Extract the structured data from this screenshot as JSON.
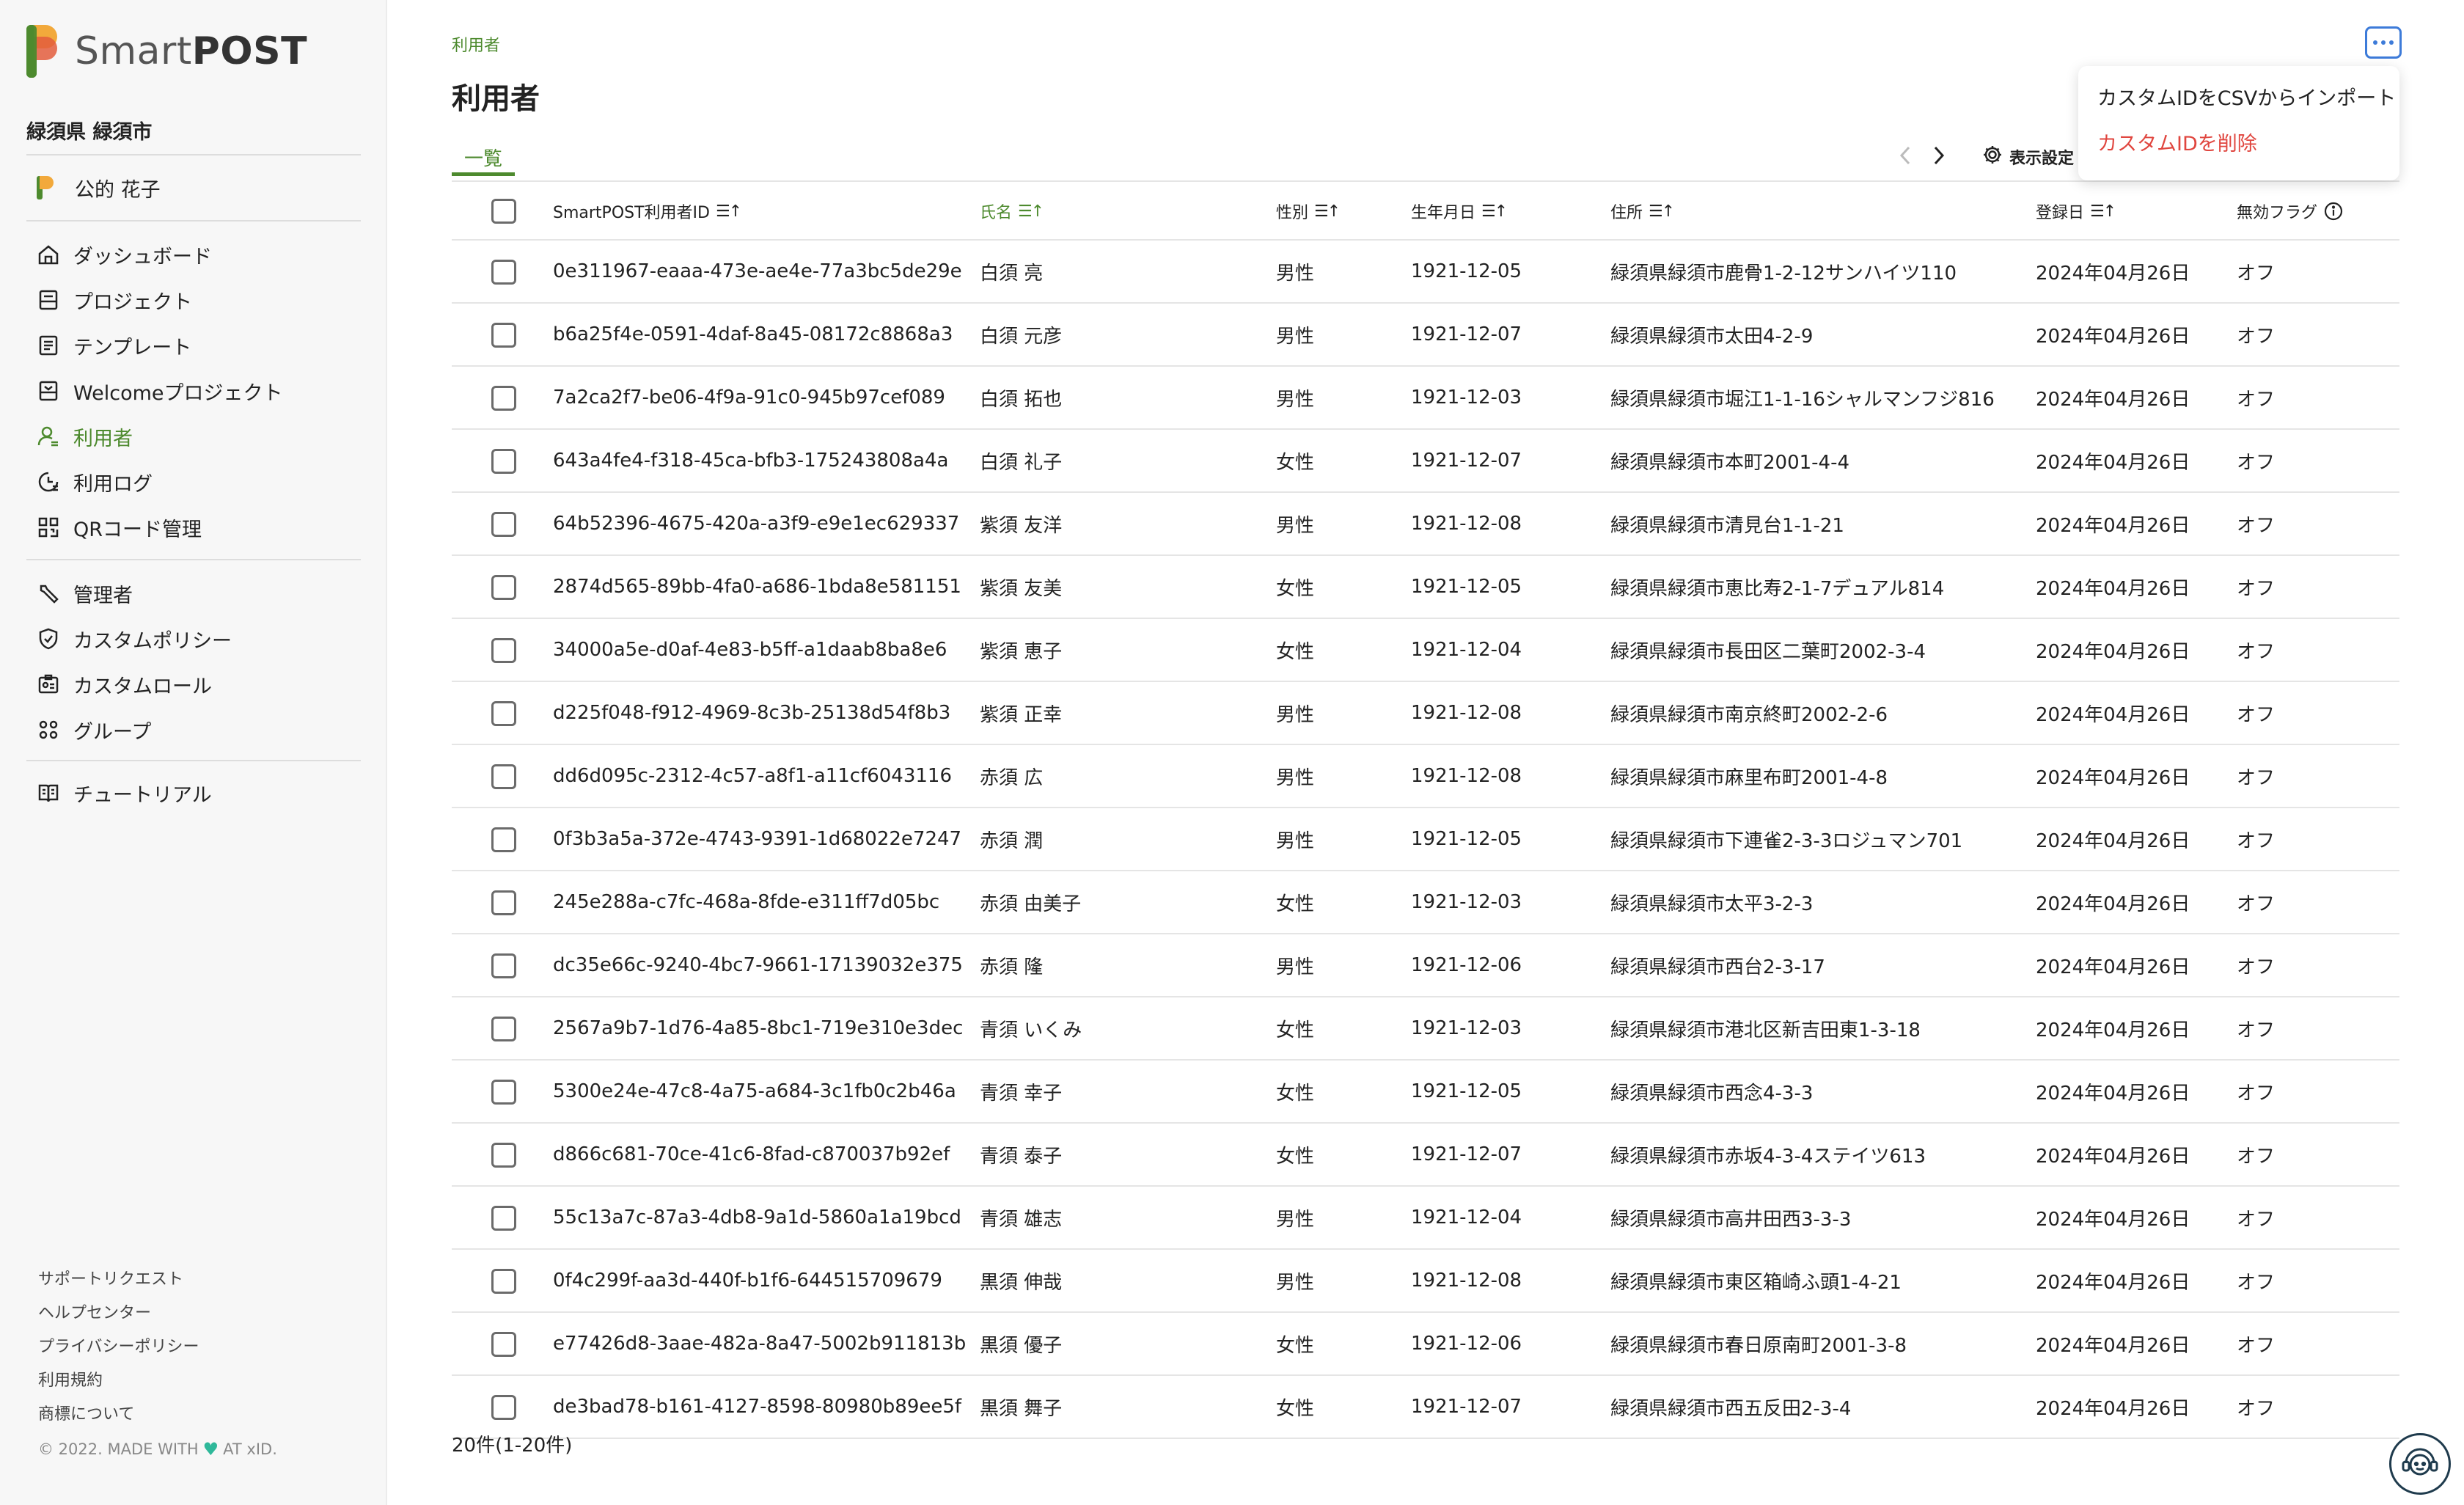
{
  "app": {
    "logo_text_light": "Smart",
    "logo_text_bold": "POST",
    "org_name": "緑須県 緑須市",
    "user_name": "公的 花子",
    "colors": {
      "accent": "#4d8a2e",
      "danger": "#e0463f",
      "focus": "#3d7bd9"
    }
  },
  "sidebar": {
    "nav_primary": [
      {
        "label": "ダッシュボード",
        "icon": "home-icon"
      },
      {
        "label": "プロジェクト",
        "icon": "project-icon"
      },
      {
        "label": "テンプレート",
        "icon": "template-icon"
      },
      {
        "label": "Welcomeプロジェクト",
        "icon": "welcome-icon"
      },
      {
        "label": "利用者",
        "icon": "user-icon",
        "active": true
      },
      {
        "label": "利用ログ",
        "icon": "log-icon"
      },
      {
        "label": "QRコード管理",
        "icon": "qr-icon"
      }
    ],
    "nav_admin": [
      {
        "label": "管理者",
        "icon": "wrench-icon"
      },
      {
        "label": "カスタムポリシー",
        "icon": "shield-icon"
      },
      {
        "label": "カスタムロール",
        "icon": "id-card-icon"
      },
      {
        "label": "グループ",
        "icon": "group-icon"
      }
    ],
    "nav_help": [
      {
        "label": "チュートリアル",
        "icon": "book-icon"
      }
    ],
    "footer_links": [
      "サポートリクエスト",
      "ヘルプセンター",
      "プライバシーポリシー",
      "利用規約",
      "商標について"
    ],
    "copyright_before": "© 2022. MADE WITH",
    "copyright_after": "AT xID."
  },
  "header": {
    "breadcrumb": "利用者",
    "title": "利用者",
    "tab": "一覧",
    "display_settings": "表示設定"
  },
  "menu": {
    "import_label": "カスタムIDをCSVからインポート",
    "delete_label": "カスタムIDを削除"
  },
  "table": {
    "columns": {
      "id": "SmartPOST利用者ID",
      "name": "氏名",
      "sex": "性別",
      "birth": "生年月日",
      "addr": "住所",
      "reg": "登録日",
      "flag": "無効フラグ"
    },
    "rows": [
      {
        "id": "0e311967-eaaa-473e-ae4e-77a3bc5de29e",
        "name": "白須 亮",
        "sex": "男性",
        "birth": "1921-12-05",
        "addr": "緑須県緑須市鹿骨1-2-12サンハイツ110",
        "reg": "2024年04月26日",
        "flag": "オフ"
      },
      {
        "id": "b6a25f4e-0591-4daf-8a45-08172c8868a3",
        "name": "白須 元彦",
        "sex": "男性",
        "birth": "1921-12-07",
        "addr": "緑須県緑須市太田4-2-9",
        "reg": "2024年04月26日",
        "flag": "オフ"
      },
      {
        "id": "7a2ca2f7-be06-4f9a-91c0-945b97cef089",
        "name": "白須 拓也",
        "sex": "男性",
        "birth": "1921-12-03",
        "addr": "緑須県緑須市堀江1-1-16シャルマンフジ816",
        "reg": "2024年04月26日",
        "flag": "オフ"
      },
      {
        "id": "643a4fe4-f318-45ca-bfb3-175243808a4a",
        "name": "白須 礼子",
        "sex": "女性",
        "birth": "1921-12-07",
        "addr": "緑須県緑須市本町2001-4-4",
        "reg": "2024年04月26日",
        "flag": "オフ"
      },
      {
        "id": "64b52396-4675-420a-a3f9-e9e1ec629337",
        "name": "紫須 友洋",
        "sex": "男性",
        "birth": "1921-12-08",
        "addr": "緑須県緑須市清見台1-1-21",
        "reg": "2024年04月26日",
        "flag": "オフ"
      },
      {
        "id": "2874d565-89bb-4fa0-a686-1bda8e581151",
        "name": "紫須 友美",
        "sex": "女性",
        "birth": "1921-12-05",
        "addr": "緑須県緑須市恵比寿2-1-7デュアル814",
        "reg": "2024年04月26日",
        "flag": "オフ"
      },
      {
        "id": "34000a5e-d0af-4e83-b5ff-a1daab8ba8e6",
        "name": "紫須 恵子",
        "sex": "女性",
        "birth": "1921-12-04",
        "addr": "緑須県緑須市長田区二葉町2002-3-4",
        "reg": "2024年04月26日",
        "flag": "オフ"
      },
      {
        "id": "d225f048-f912-4969-8c3b-25138d54f8b3",
        "name": "紫須 正幸",
        "sex": "男性",
        "birth": "1921-12-08",
        "addr": "緑須県緑須市南京終町2002-2-6",
        "reg": "2024年04月26日",
        "flag": "オフ"
      },
      {
        "id": "dd6d095c-2312-4c57-a8f1-a11cf6043116",
        "name": "赤須 広",
        "sex": "男性",
        "birth": "1921-12-08",
        "addr": "緑須県緑須市麻里布町2001-4-8",
        "reg": "2024年04月26日",
        "flag": "オフ"
      },
      {
        "id": "0f3b3a5a-372e-4743-9391-1d68022e7247",
        "name": "赤須 潤",
        "sex": "男性",
        "birth": "1921-12-05",
        "addr": "緑須県緑須市下連雀2-3-3ロジュマン701",
        "reg": "2024年04月26日",
        "flag": "オフ"
      },
      {
        "id": "245e288a-c7fc-468a-8fde-e311ff7d05bc",
        "name": "赤須 由美子",
        "sex": "女性",
        "birth": "1921-12-03",
        "addr": "緑須県緑須市太平3-2-3",
        "reg": "2024年04月26日",
        "flag": "オフ"
      },
      {
        "id": "dc35e66c-9240-4bc7-9661-17139032e375",
        "name": "赤須 隆",
        "sex": "男性",
        "birth": "1921-12-06",
        "addr": "緑須県緑須市西台2-3-17",
        "reg": "2024年04月26日",
        "flag": "オフ"
      },
      {
        "id": "2567a9b7-1d76-4a85-8bc1-719e310e3dec",
        "name": "青須 いくみ",
        "sex": "女性",
        "birth": "1921-12-03",
        "addr": "緑須県緑須市港北区新吉田東1-3-18",
        "reg": "2024年04月26日",
        "flag": "オフ"
      },
      {
        "id": "5300e24e-47c8-4a75-a684-3c1fb0c2b46a",
        "name": "青須 幸子",
        "sex": "女性",
        "birth": "1921-12-05",
        "addr": "緑須県緑須市西念4-3-3",
        "reg": "2024年04月26日",
        "flag": "オフ"
      },
      {
        "id": "d866c681-70ce-41c6-8fad-c870037b92ef",
        "name": "青須 泰子",
        "sex": "女性",
        "birth": "1921-12-07",
        "addr": "緑須県緑須市赤坂4-3-4ステイツ613",
        "reg": "2024年04月26日",
        "flag": "オフ"
      },
      {
        "id": "55c13a7c-87a3-4db8-9a1d-5860a1a19bcd",
        "name": "青須 雄志",
        "sex": "男性",
        "birth": "1921-12-04",
        "addr": "緑須県緑須市高井田西3-3-3",
        "reg": "2024年04月26日",
        "flag": "オフ"
      },
      {
        "id": "0f4c299f-aa3d-440f-b1f6-644515709679",
        "name": "黒須 伸哉",
        "sex": "男性",
        "birth": "1921-12-08",
        "addr": "緑須県緑須市東区箱崎ふ頭1-4-21",
        "reg": "2024年04月26日",
        "flag": "オフ"
      },
      {
        "id": "e77426d8-3aae-482a-8a47-5002b911813b",
        "name": "黒須 優子",
        "sex": "女性",
        "birth": "1921-12-06",
        "addr": "緑須県緑須市春日原南町2001-3-8",
        "reg": "2024年04月26日",
        "flag": "オフ"
      },
      {
        "id": "de3bad78-b161-4127-8598-80980b89ee5f",
        "name": "黒須 舞子",
        "sex": "女性",
        "birth": "1921-12-07",
        "addr": "緑須県緑須市西五反田2-3-4",
        "reg": "2024年04月26日",
        "flag": "オフ"
      }
    ],
    "count_label": "20件(1-20件)"
  }
}
